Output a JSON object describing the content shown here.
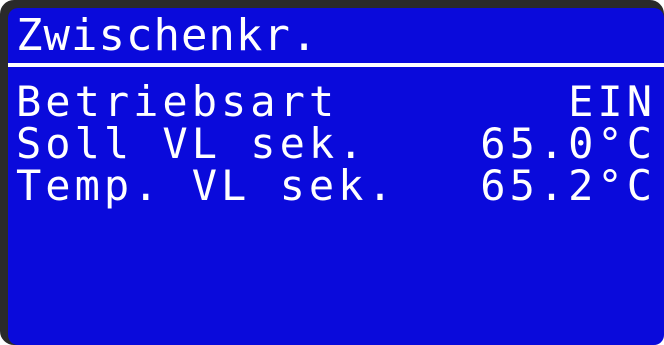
{
  "screen": {
    "title": "Zwischenkr.",
    "background_color": "#0a0adb",
    "text_color": "#ffffff"
  },
  "rows": [
    {
      "label": "Betriebsart",
      "value": "EIN"
    },
    {
      "label": "Soll VL sek.",
      "value": "65.0°C"
    },
    {
      "label": "Temp. VL sek.",
      "value": "65.2°C"
    }
  ]
}
